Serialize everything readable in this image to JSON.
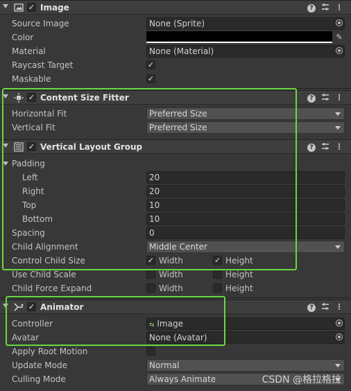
{
  "image": {
    "title": "Image",
    "rows": [
      {
        "label": "Source Image",
        "value": "None (Sprite)"
      },
      {
        "label": "Color",
        "value": ""
      },
      {
        "label": "Material",
        "value": "None (Material)"
      },
      {
        "label": "Raycast Target",
        "checked": true
      },
      {
        "label": "Maskable",
        "checked": true
      }
    ]
  },
  "csf": {
    "title": "Content Size Fitter",
    "horizontal_label": "Horizontal Fit",
    "horizontal_value": "Preferred Size",
    "vertical_label": "Vertical Fit",
    "vertical_value": "Preferred Size"
  },
  "vlg": {
    "title": "Vertical Layout Group",
    "padding_label": "Padding",
    "left_label": "Left",
    "left_value": "20",
    "right_label": "Right",
    "right_value": "20",
    "top_label": "Top",
    "top_value": "10",
    "bottom_label": "Bottom",
    "bottom_value": "10",
    "spacing_label": "Spacing",
    "spacing_value": "0",
    "alignment_label": "Child Alignment",
    "alignment_value": "Middle Center",
    "control_label": "Control Child Size",
    "scale_label": "Use Child Scale",
    "expand_label": "Child Force Expand",
    "width_label": "Width",
    "height_label": "Height"
  },
  "animator": {
    "title": "Animator",
    "controller_label": "Controller",
    "controller_value": "Image",
    "avatar_label": "Avatar",
    "avatar_value": "None (Avatar)",
    "root_motion_label": "Apply Root Motion",
    "update_label": "Update Mode",
    "update_value": "Normal",
    "culling_label": "Culling Mode",
    "culling_value": "Always Animate"
  },
  "header_buttons": {
    "help": "?",
    "more": "⋮"
  },
  "watermark": "CSDN @格拉格拉",
  "colors": {
    "highlight": "#6ad93e",
    "background": "#383838",
    "header": "#3e3e3e"
  }
}
